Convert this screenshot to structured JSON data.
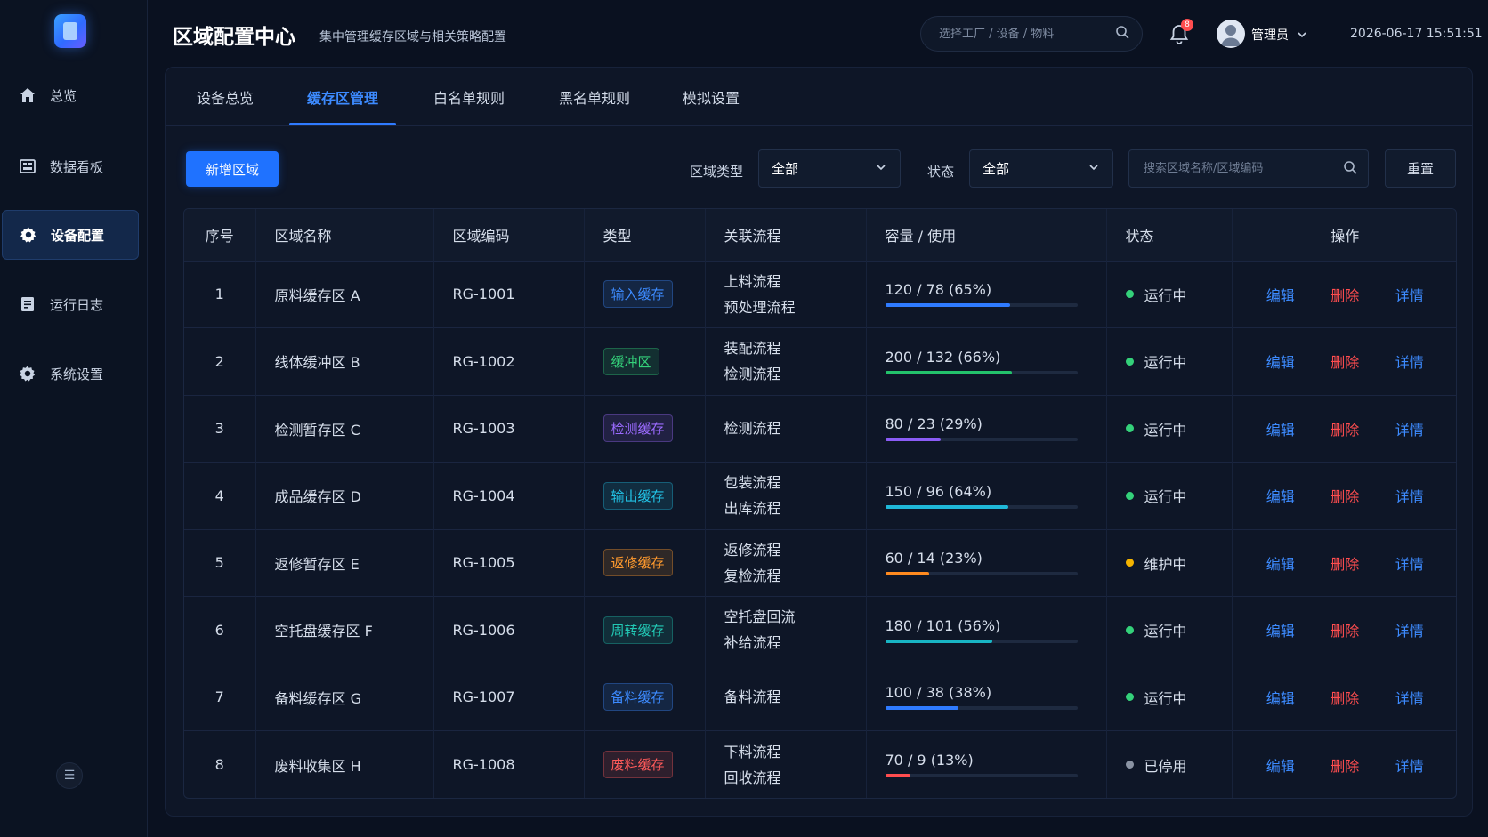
{
  "sidebar": {
    "items": [
      {
        "label": "总览",
        "icon": "home-icon"
      },
      {
        "label": "数据看板",
        "icon": "dashboard-icon"
      },
      {
        "label": "设备配置",
        "icon": "gear-icon"
      },
      {
        "label": "运行日志",
        "icon": "document-icon"
      },
      {
        "label": "系统设置",
        "icon": "gear-icon"
      }
    ],
    "active_index": 2,
    "collapse_icon": "menu-icon"
  },
  "header": {
    "title": "区域配置中心",
    "subtitle": "集中管理缓存区域与相关策略配置",
    "search_placeholder": "选择工厂 / 设备 / 物料",
    "notification_count": "8",
    "user_name": "管理员",
    "datetime": "2026-06-17 15:51:51"
  },
  "tabs": [
    "设备总览",
    "缓存区管理",
    "白名单规则",
    "黑名单规则",
    "模拟设置"
  ],
  "active_tab": 1,
  "toolbar": {
    "add_label": "新增区域",
    "region_type_label": "区域类型",
    "region_type_value": "全部",
    "status_label": "状态",
    "status_value": "全部",
    "search_placeholder": "搜索区域名称/区域编码",
    "reset_label": "重置"
  },
  "table": {
    "columns": [
      "序号",
      "区域名称",
      "区域编码",
      "类型",
      "关联流程",
      "容量 / 使用",
      "状态",
      "操作"
    ],
    "actions": {
      "edit": "编辑",
      "delete": "删除",
      "detail": "详情"
    },
    "rows": [
      {
        "idx": "1",
        "name": "原料缓存区 A",
        "code": "RG-1001",
        "type": "输入缓存",
        "type_color": "#3d8bff",
        "flows": [
          "上料流程",
          "预处理流程"
        ],
        "capacity": "120 / 78 (65%)",
        "usage": 0.65,
        "bar_color": "#2f7bff",
        "status": "运行中",
        "status_color": "#34d17a"
      },
      {
        "idx": "2",
        "name": "线体缓冲区 B",
        "code": "RG-1002",
        "type": "缓冲区",
        "type_color": "#34d17a",
        "flows": [
          "装配流程",
          "检测流程"
        ],
        "capacity": "200 / 132 (66%)",
        "usage": 0.66,
        "bar_color": "#23c26b",
        "status": "运行中",
        "status_color": "#34d17a"
      },
      {
        "idx": "3",
        "name": "检测暂存区 C",
        "code": "RG-1003",
        "type": "检测缓存",
        "type_color": "#9b6bff",
        "flows": [
          "检测流程"
        ],
        "capacity": "80 / 23 (29%)",
        "usage": 0.29,
        "bar_color": "#8b5cf6",
        "status": "运行中",
        "status_color": "#34d17a"
      },
      {
        "idx": "4",
        "name": "成品缓存区 D",
        "code": "RG-1004",
        "type": "输出缓存",
        "type_color": "#22c3e6",
        "flows": [
          "包装流程",
          "出库流程"
        ],
        "capacity": "150 / 96 (64%)",
        "usage": 0.64,
        "bar_color": "#1fb8d8",
        "status": "运行中",
        "status_color": "#34d17a"
      },
      {
        "idx": "5",
        "name": "返修暂存区 E",
        "code": "RG-1005",
        "type": "返修缓存",
        "type_color": "#ff9a2e",
        "flows": [
          "返修流程",
          "复检流程"
        ],
        "capacity": "60 / 14 (23%)",
        "usage": 0.23,
        "bar_color": "#ff8a1f",
        "status": "维护中",
        "status_color": "#f5b400"
      },
      {
        "idx": "6",
        "name": "空托盘缓存区 F",
        "code": "RG-1006",
        "type": "周转缓存",
        "type_color": "#22c9b5",
        "flows": [
          "空托盘回流",
          "补给流程"
        ],
        "capacity": "180 / 101 (56%)",
        "usage": 0.56,
        "bar_color": "#18b5c4",
        "status": "运行中",
        "status_color": "#34d17a"
      },
      {
        "idx": "7",
        "name": "备料缓存区 G",
        "code": "RG-1007",
        "type": "备料缓存",
        "type_color": "#3d8bff",
        "flows": [
          "备料流程"
        ],
        "capacity": "100 / 38 (38%)",
        "usage": 0.38,
        "bar_color": "#2f7bff",
        "status": "运行中",
        "status_color": "#34d17a"
      },
      {
        "idx": "8",
        "name": "废料收集区 H",
        "code": "RG-1008",
        "type": "废料缓存",
        "type_color": "#ff5a5a",
        "flows": [
          "下料流程",
          "回收流程"
        ],
        "capacity": "70 / 9 (13%)",
        "usage": 0.13,
        "bar_color": "#ff4d4f",
        "status": "已停用",
        "status_color": "#8a93a3"
      }
    ]
  }
}
